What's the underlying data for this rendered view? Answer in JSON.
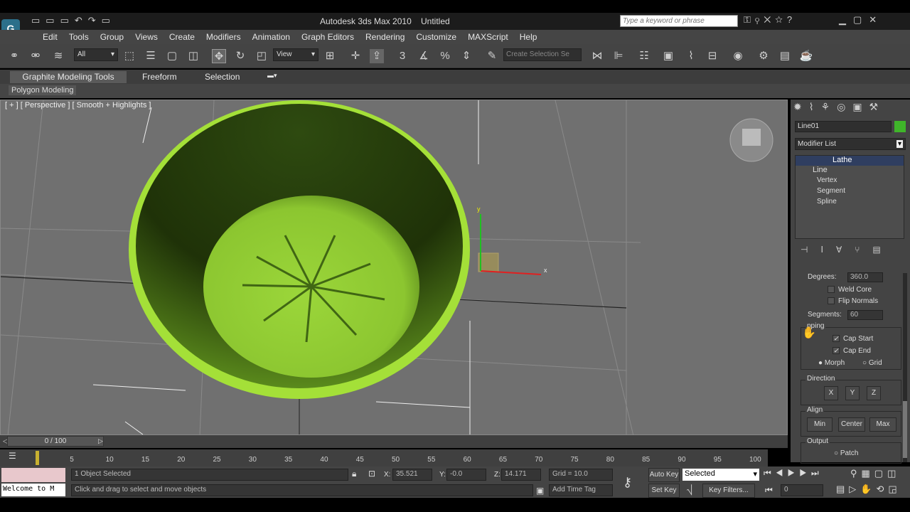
{
  "title": {
    "app": "Autodesk 3ds Max 2010",
    "doc": "Untitled",
    "search_placeholder": "Type a keyword or phrase"
  },
  "menu": [
    "Edit",
    "Tools",
    "Group",
    "Views",
    "Create",
    "Modifiers",
    "Animation",
    "Graph Editors",
    "Rendering",
    "Customize",
    "MAXScript",
    "Help"
  ],
  "toolbar": {
    "selection_filter": "All",
    "ref_coord": "View",
    "named_selection": "Create Selection Se"
  },
  "ribbon": {
    "tabs": [
      "Graphite Modeling Tools",
      "Freeform",
      "Selection"
    ],
    "panel": "Polygon Modeling"
  },
  "viewport": {
    "label": "[ + ] [ Perspective ] [ Smooth + Highlights ]",
    "axis_x": "x",
    "axis_y": "y",
    "bowl_color": "#8ccf2c"
  },
  "command_panel": {
    "object_name": "Line01",
    "object_color": "#3fb52a",
    "modifier_list": "Modifier List",
    "stack": [
      {
        "label": "Lathe",
        "level": 0,
        "selected": true
      },
      {
        "label": "Line",
        "level": 0
      },
      {
        "label": "Vertex",
        "level": 1
      },
      {
        "label": "Segment",
        "level": 1
      },
      {
        "label": "Spline",
        "level": 1
      }
    ],
    "degrees_label": "Degrees:",
    "degrees": "360.0",
    "weld_core": "Weld Core",
    "flip_normals": "Flip Normals",
    "segments_label": "Segments:",
    "segments": "60",
    "capping": "pping",
    "cap_start": "Cap Start",
    "cap_end": "Cap End",
    "morph": "Morph",
    "grid": "Grid",
    "direction": "Direction",
    "dir_buttons": [
      "X",
      "Y",
      "Z"
    ],
    "align": "Align",
    "align_buttons": [
      "Min",
      "Center",
      "Max"
    ],
    "output": "Output",
    "patch": "Patch"
  },
  "timeline": {
    "frame": "0 / 100",
    "ticks": [
      "0",
      "5",
      "10",
      "15",
      "20",
      "25",
      "30",
      "35",
      "40",
      "45",
      "50",
      "55",
      "60",
      "65",
      "70",
      "75",
      "80",
      "85",
      "90",
      "95",
      "100"
    ]
  },
  "status": {
    "selected": "1 Object Selected",
    "prompt": "Click and drag to select and move objects",
    "x_label": "X:",
    "x": "35.521",
    "y_label": "Y:",
    "y": "-0.0",
    "z_label": "Z:",
    "z": "14.171",
    "grid": "Grid = 10.0",
    "add_time_tag": "Add Time Tag",
    "auto_key": "Auto Key",
    "set_key": "Set Key",
    "key_mode": "Selected",
    "key_filters": "Key Filters...",
    "current_frame": "0",
    "maxscript": "Welcome to M"
  }
}
